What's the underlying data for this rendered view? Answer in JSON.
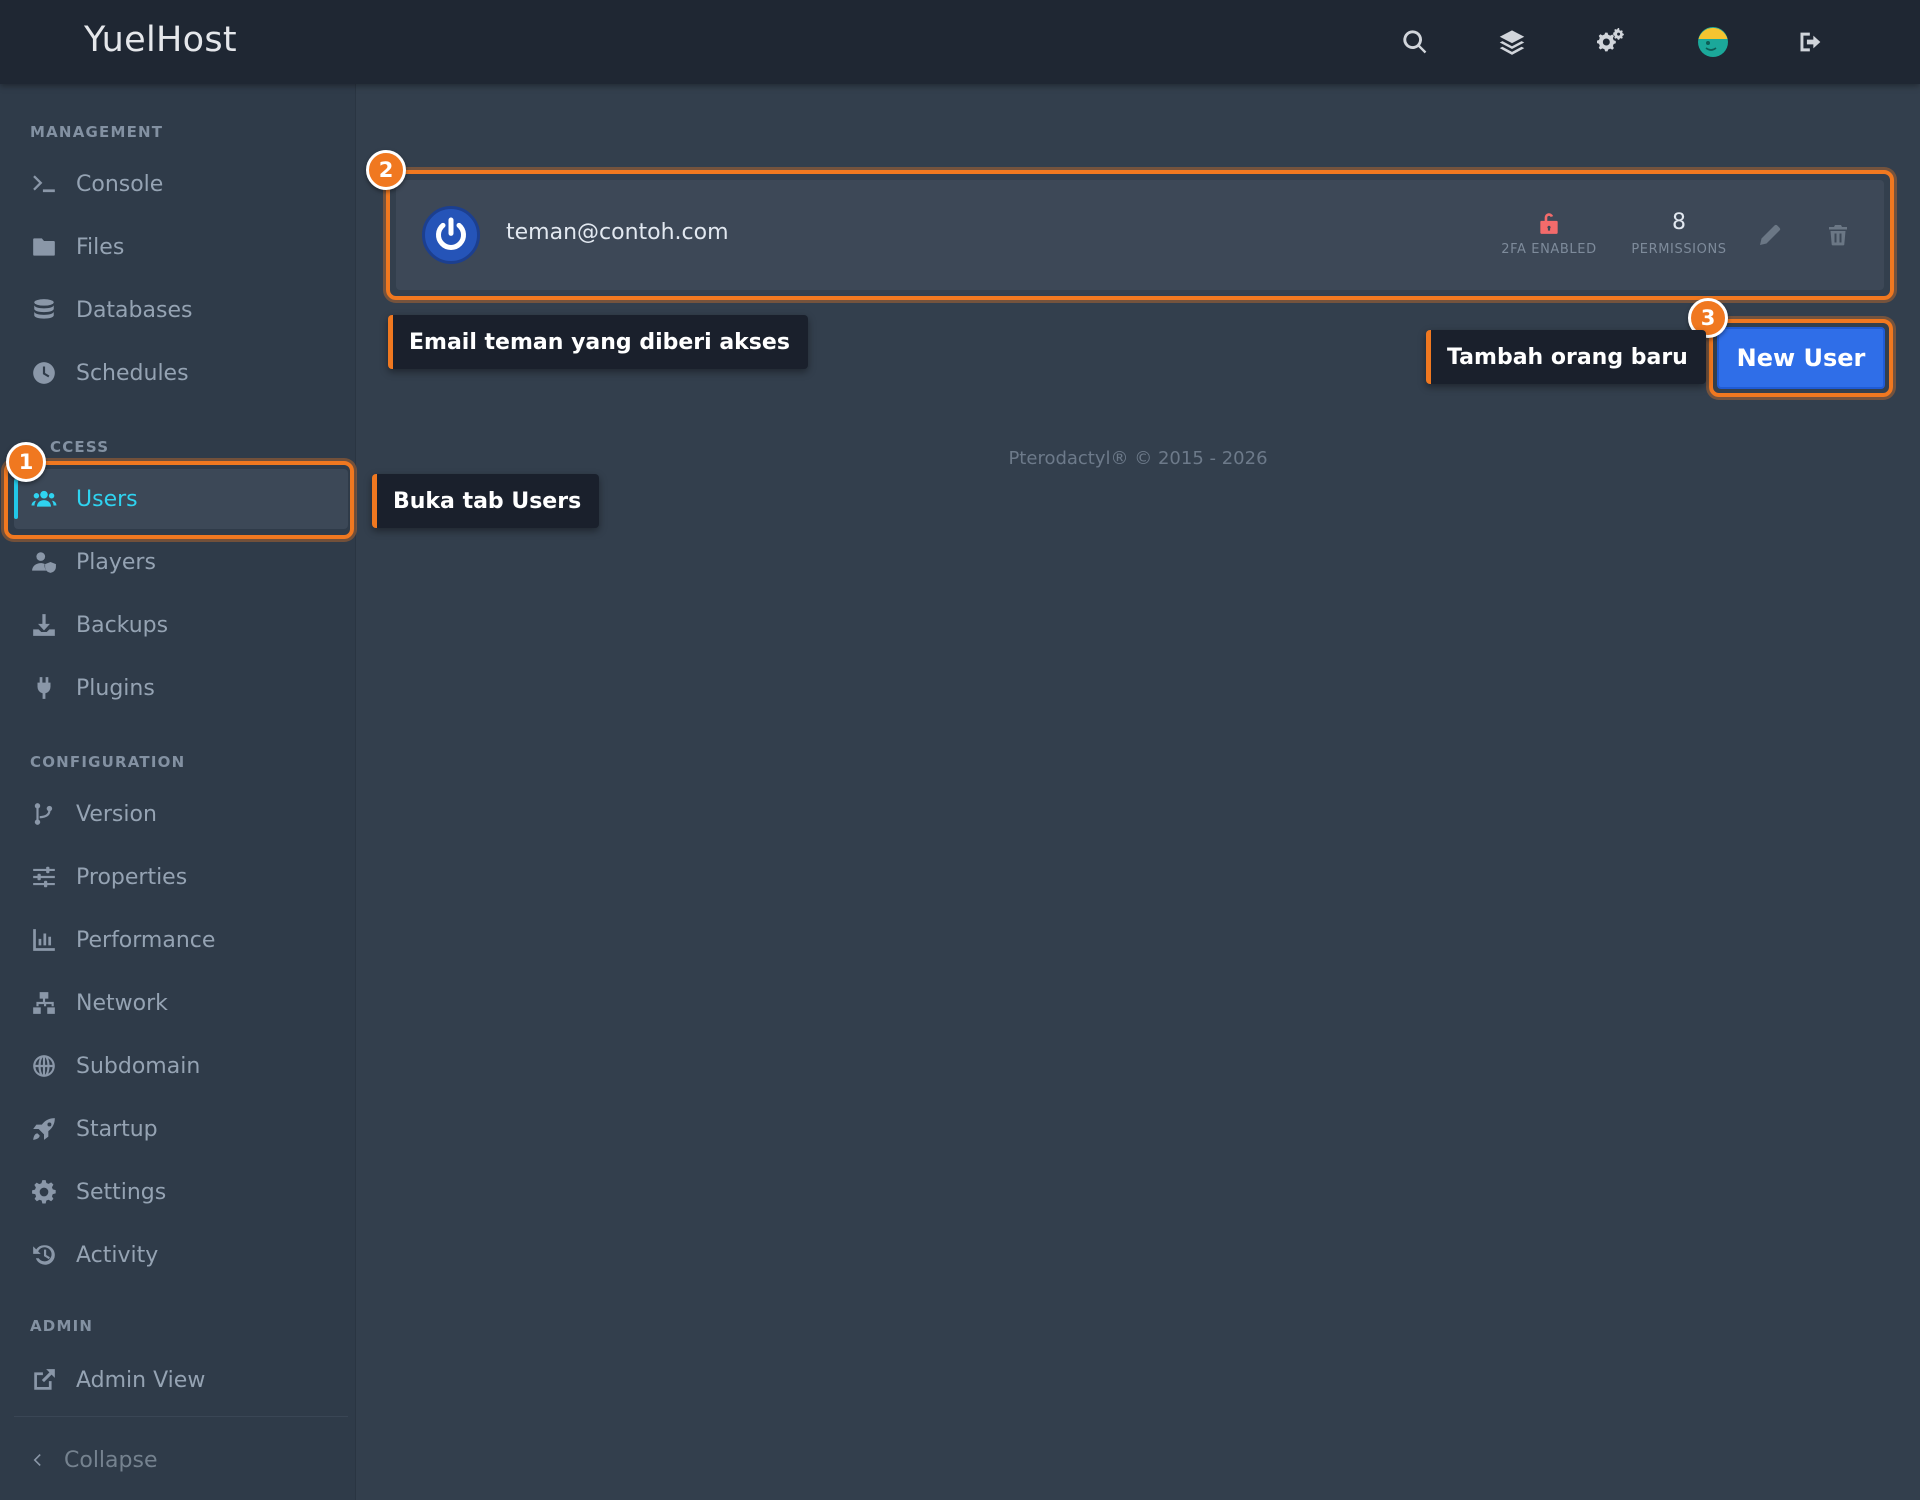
{
  "app": {
    "brand": "YuelHost"
  },
  "topbar": {
    "icons": [
      "search-icon",
      "layers-icon",
      "cogs-icon",
      "avatar-icon",
      "sign-out-icon"
    ]
  },
  "sidebar": {
    "sections": {
      "management": "MANAGEMENT",
      "access": "CCESS",
      "configuration": "CONFIGURATION",
      "admin": "ADMIN"
    },
    "items": {
      "console": "Console",
      "files": "Files",
      "databases": "Databases",
      "schedules": "Schedules",
      "users": "Users",
      "players": "Players",
      "backups": "Backups",
      "plugins": "Plugins",
      "version": "Version",
      "properties": "Properties",
      "performance": "Performance",
      "network": "Network",
      "subdomain": "Subdomain",
      "startup": "Startup",
      "settings": "Settings",
      "activity": "Activity",
      "admin_view": "Admin View"
    },
    "collapse": "Collapse",
    "active_item": "Users",
    "accent_color": "#2fd3f0"
  },
  "main": {
    "user": {
      "email": "teman@contoh.com",
      "twofa_label": "2FA ENABLED",
      "permissions_count": "8",
      "permissions_label": "PERMISSIONS"
    },
    "new_user_label": "New User",
    "footer": "Pterodactyl® © 2015 - 2026"
  },
  "annotations": {
    "step1_number": "1",
    "step1_text": "Buka tab Users",
    "step2_number": "2",
    "step2_text": "Email teman yang diberi akses",
    "step3_number": "3",
    "step3_text": "Tambah orang baru",
    "highlight_color": "#f07820"
  }
}
